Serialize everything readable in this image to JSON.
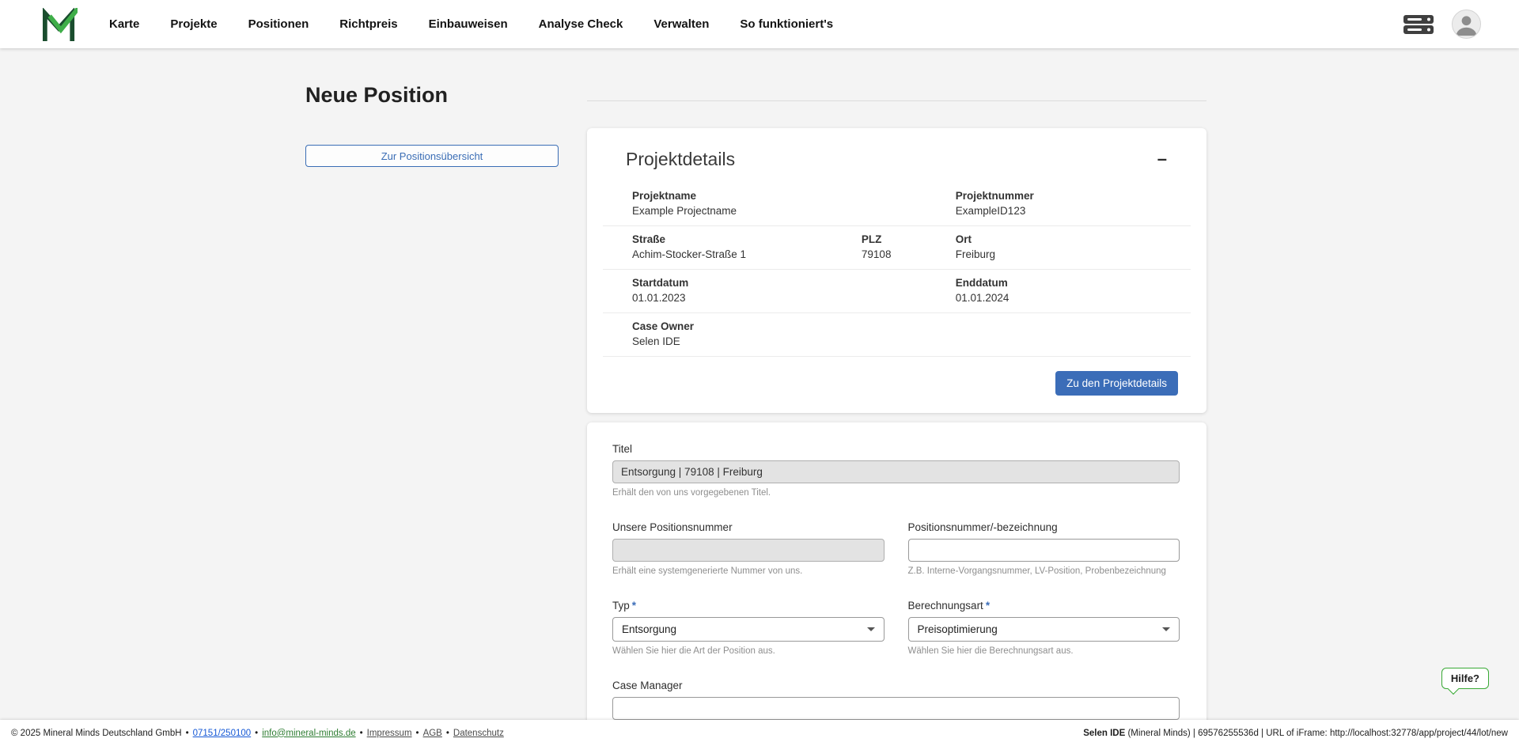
{
  "header": {
    "nav": [
      "Karte",
      "Projekte",
      "Positionen",
      "Richtpreis",
      "Einbauweisen",
      "Analyse Check",
      "Verwalten",
      "So funktioniert's"
    ]
  },
  "page": {
    "title": "Neue Position",
    "back_button": "Zur Positionsübersicht"
  },
  "project_card": {
    "title": "Projektdetails",
    "collapse_icon": "–",
    "projektname": {
      "label": "Projektname",
      "value": "Example Projectname"
    },
    "projektnummer": {
      "label": "Projektnummer",
      "value": "ExampleID123"
    },
    "strasse": {
      "label": "Straße",
      "value": "Achim-Stocker-Straße 1"
    },
    "plz": {
      "label": "PLZ",
      "value": "79108"
    },
    "ort": {
      "label": "Ort",
      "value": "Freiburg"
    },
    "startdatum": {
      "label": "Startdatum",
      "value": "01.01.2023"
    },
    "enddatum": {
      "label": "Enddatum",
      "value": "01.01.2024"
    },
    "case_owner": {
      "label": "Case Owner",
      "value": "Selen IDE"
    },
    "button": "Zu den Projektdetails"
  },
  "form_card": {
    "titel": {
      "label": "Titel",
      "value": "Entsorgung | 79108 | Freiburg",
      "helper": "Erhält den von uns vorgegebenen Titel."
    },
    "unsere_nr": {
      "label": "Unsere Positionsnummer",
      "value": "",
      "helper": "Erhält eine systemgenerierte Nummer von uns."
    },
    "pos_nr": {
      "label": "Positionsnummer/-bezeichnung",
      "value": "",
      "helper": "Z.B. Interne-Vorgangsnummer, LV-Position, Probenbezeichnung"
    },
    "typ": {
      "label": "Typ",
      "required": "*",
      "value": "Entsorgung",
      "helper": "Wählen Sie hier die Art der Position aus."
    },
    "berechnungsart": {
      "label": "Berechnungsart",
      "required": "*",
      "value": "Preisoptimierung",
      "helper": "Wählen Sie hier die Berechnungsart aus."
    },
    "case_manager": {
      "label": "Case Manager",
      "value": ""
    }
  },
  "help": {
    "label": "Hilfe?"
  },
  "footer": {
    "copyright": "© 2025 Mineral Minds Deutschland GmbH",
    "separator": "•",
    "phone": "07151/250100",
    "email": "info@mineral-minds.de",
    "impressum": "Impressum",
    "agb": "AGB",
    "datenschutz": "Datenschutz",
    "user_bold": "Selen IDE",
    "user_rest": " (Mineral Minds) | 69576255536d | URL of iFrame: http://localhost:32778/app/project/44/lot/new"
  },
  "colors": {
    "primary_blue": "#3b6db8",
    "brand_green_dark": "#1a4d2e",
    "brand_green_light": "#3fae49",
    "help_border_green": "#39a935"
  }
}
